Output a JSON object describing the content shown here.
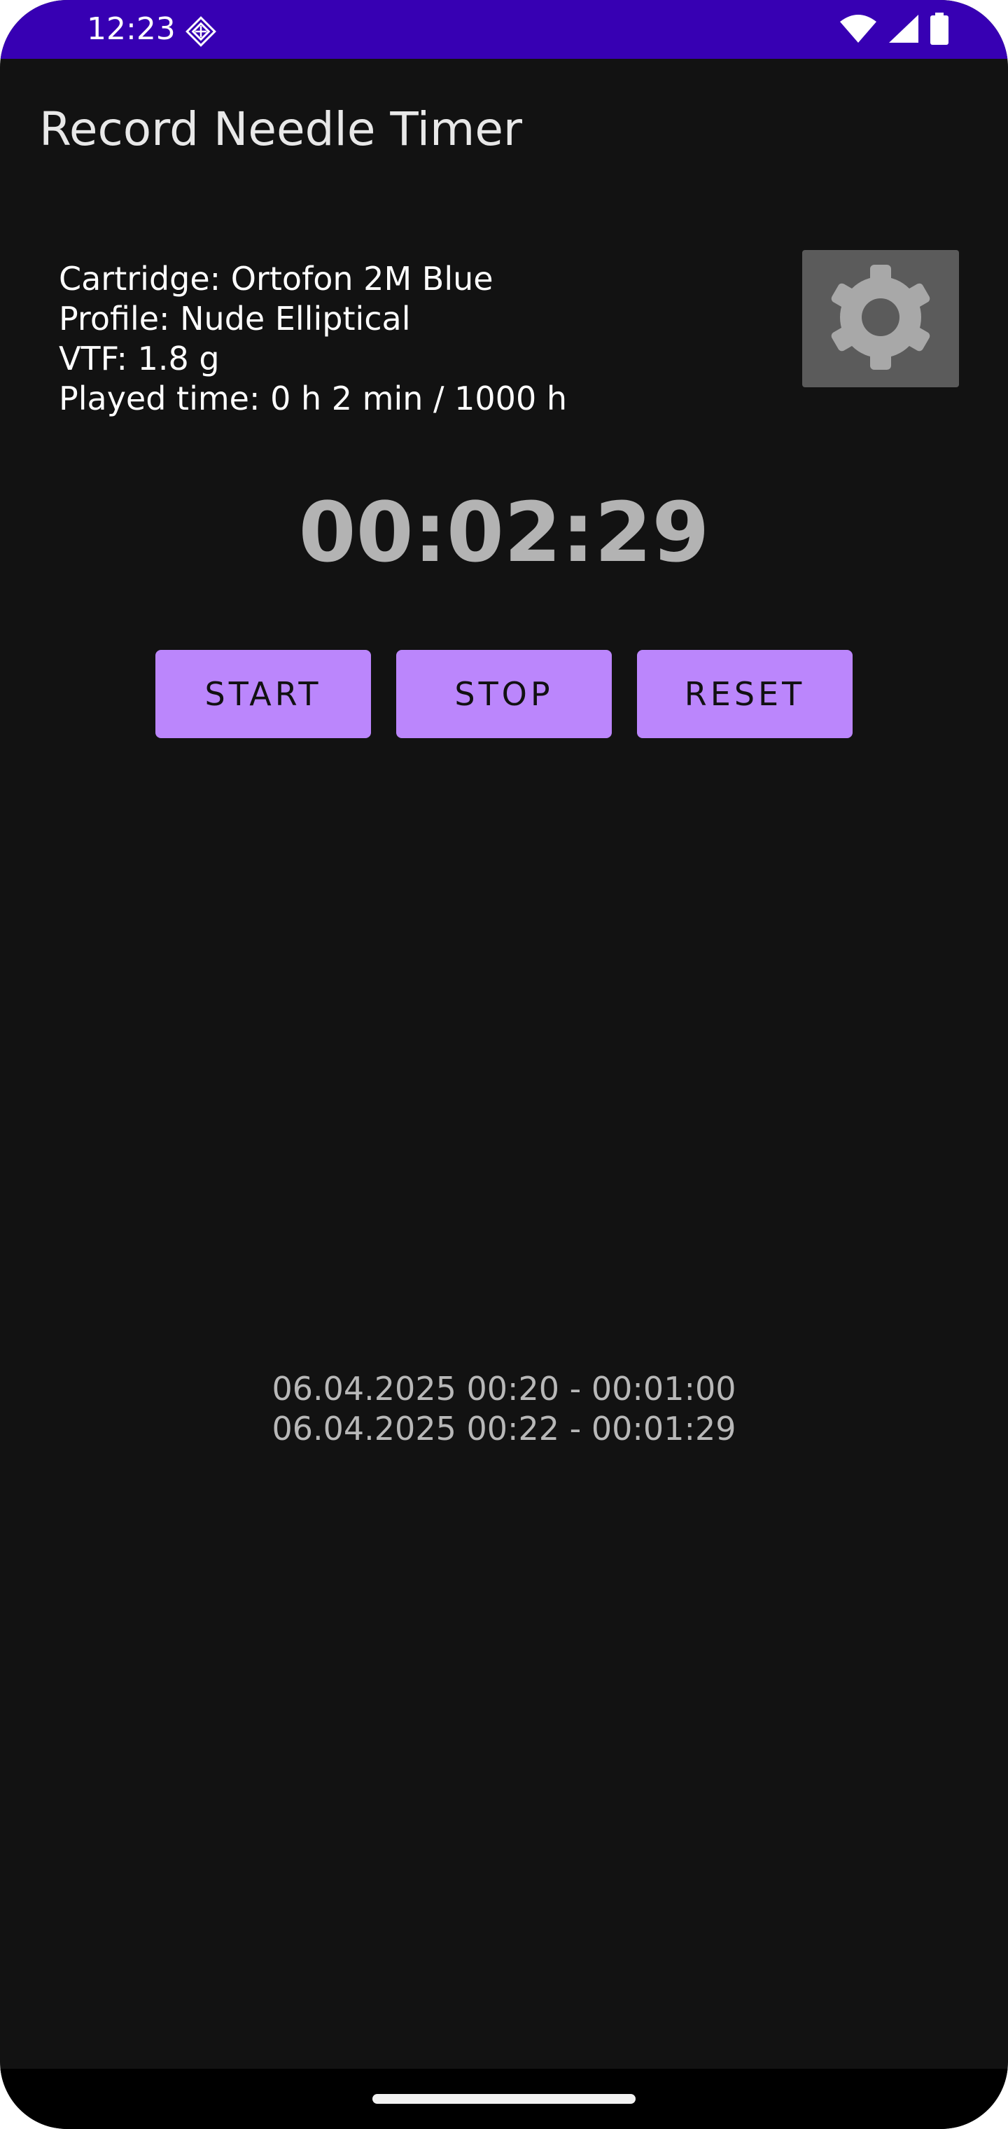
{
  "status_bar": {
    "time": "12:23",
    "icons": [
      "app-notification-icon",
      "wifi-icon",
      "cellular-signal-icon",
      "battery-icon"
    ],
    "background_color": "#3700b3"
  },
  "app": {
    "title": "Record Needle Timer"
  },
  "cartridge_info": {
    "cartridge": "Cartridge: Ortofon 2M Blue",
    "profile": "Profile: Nude Elliptical",
    "vtf": "VTF: 1.8 g",
    "played_time": "Played time: 0 h 2 min / 1000 h"
  },
  "settings": {
    "icon": "gear-icon"
  },
  "timer": {
    "value": "00:02:29"
  },
  "controls": {
    "start_label": "START",
    "stop_label": "STOP",
    "reset_label": "RESET",
    "accent_color": "#bb86fc"
  },
  "history": [
    "06.04.2025 00:20 - 00:01:00",
    "06.04.2025 00:22 - 00:01:29"
  ]
}
